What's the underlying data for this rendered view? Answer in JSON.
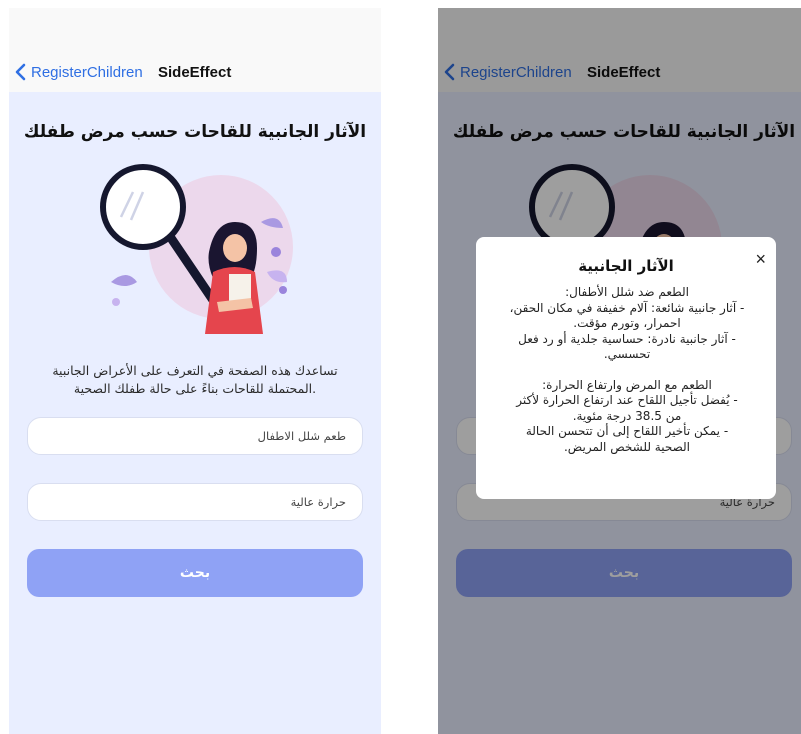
{
  "navbar": {
    "back_label": "RegisterChildren",
    "title": "SideEffect"
  },
  "page": {
    "title": "الآثار الجانبية للقاحات حسب مرض طفلك",
    "description_line1": "تساعدك هذه الصفحة في التعرف على الأعراض الجانبية",
    "description_line2": "المحتملة للقاحات بناءً على حالة طفلك الصحية."
  },
  "form": {
    "vaccine_value": "طعم شلل الاطفال",
    "condition_value": "حرارة عالية",
    "search_label": "بحث"
  },
  "dialog": {
    "close_symbol": "×",
    "title": "الآثار الجانبية",
    "lines": [
      "الطعم ضد شلل الأطفال:",
      "- آثار جانبية شائعة: آلام خفيفة في مكان الحقن،",
      "احمرار، وتورم مؤقت.",
      "- آثار جانبية نادرة: حساسية جلدية أو رد فعل",
      "تحسسي.",
      "الطعم مع المرض وارتفاع الحرارة:",
      "- يُفضل تأجيل اللقاح عند ارتفاع الحرارة لأكثر",
      "من 38.5 درجة مئوية.",
      "- يمكن تأخير اللقاح إلى أن تتحسن الحالة",
      "الصحية للشخص المريض."
    ]
  },
  "colors": {
    "accent": "#2f6fe3",
    "background": "#e9eeff",
    "button": "#8fa2f5"
  }
}
